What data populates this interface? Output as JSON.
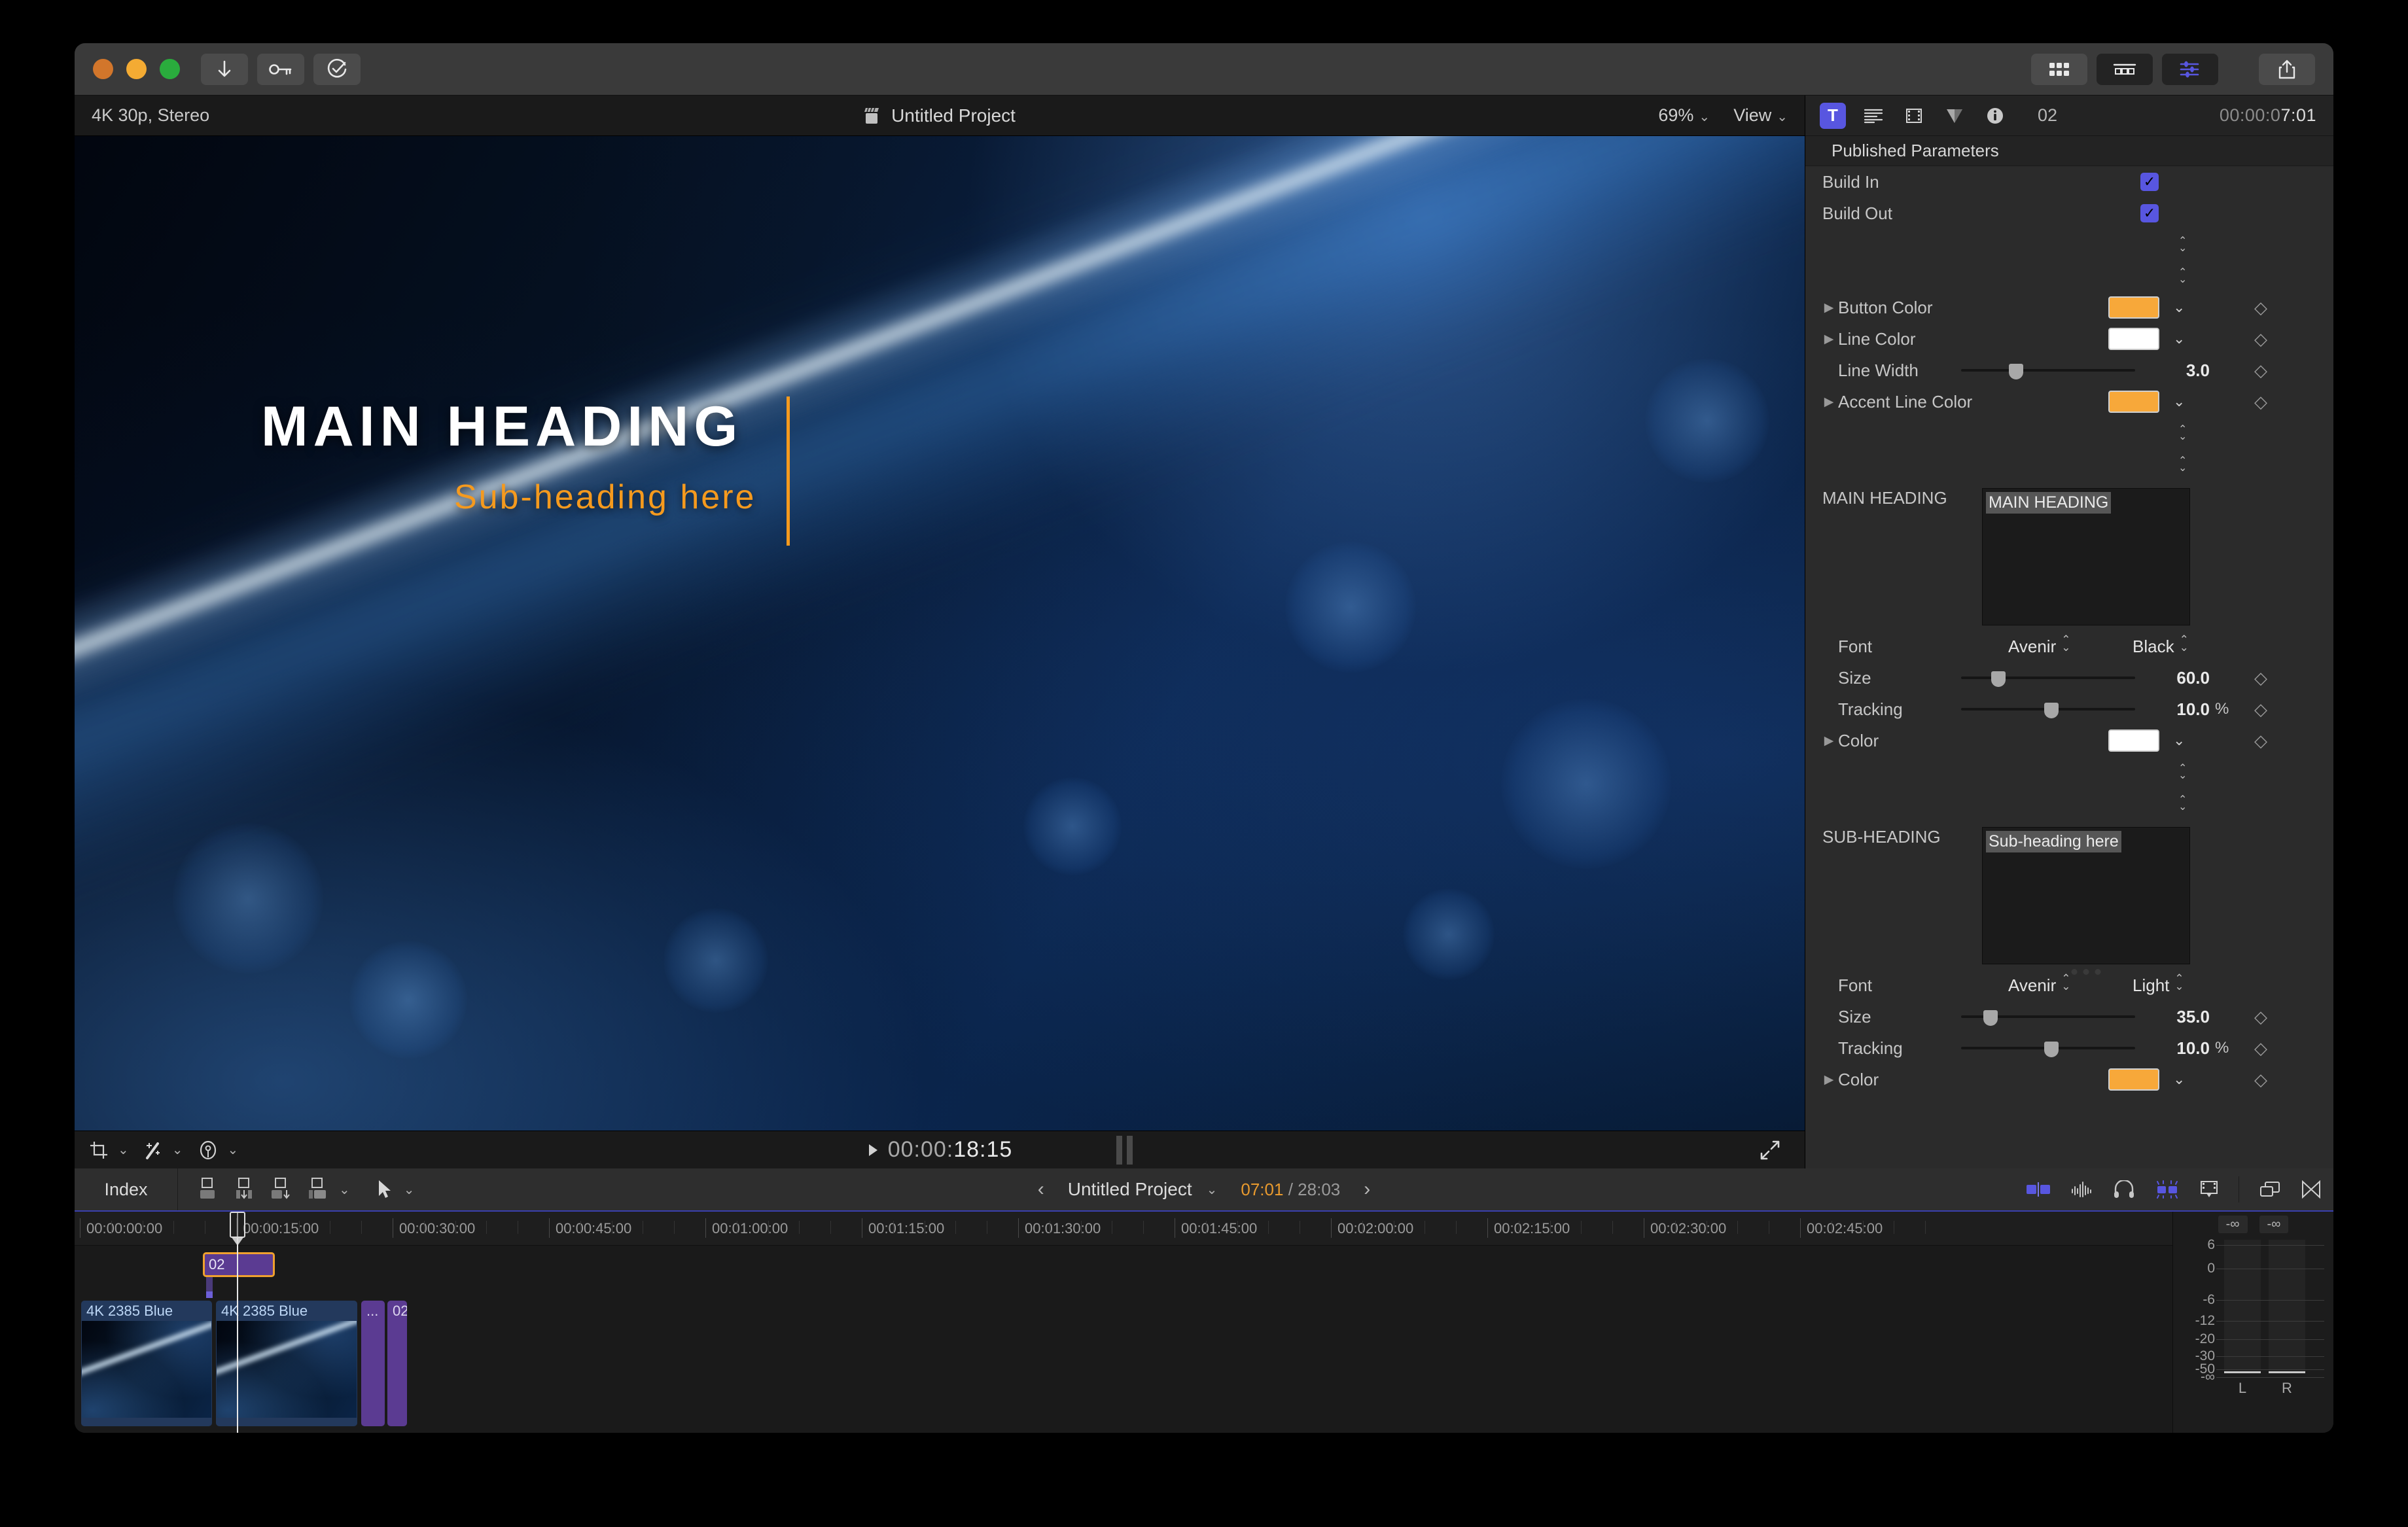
{
  "titlebar": {
    "buttons": [
      {
        "name": "download-button",
        "icon": "arrow-down-icon"
      },
      {
        "name": "keyword-button",
        "icon": "key-icon"
      },
      {
        "name": "analysis-button",
        "icon": "check-circle-icon"
      }
    ],
    "right_buttons": [
      {
        "name": "browser-button",
        "icon": "grid-icon"
      },
      {
        "name": "timeline-button",
        "icon": "filmstrip-icon"
      },
      {
        "name": "inspector-button",
        "icon": "sliders-icon"
      },
      {
        "name": "share-button",
        "icon": "share-icon"
      }
    ]
  },
  "viewer": {
    "format": "4K 30p, Stereo",
    "project_title": "Untitled Project",
    "zoom": "69%",
    "view_label": "View",
    "title_text": "MAIN HEADING",
    "sub_text": "Sub-heading here",
    "timecode_prefix": "00:00:",
    "timecode_main": "18:15",
    "tools": [
      "crop-icon",
      "transform-icon",
      "color-board-icon"
    ]
  },
  "inspector": {
    "tabs": [
      {
        "name": "text-tab",
        "label": "T",
        "active": true
      },
      {
        "name": "paragraph-tab",
        "label": "",
        "active": false
      },
      {
        "name": "video-tab",
        "label": "",
        "active": false
      },
      {
        "name": "generator-tab",
        "label": "",
        "active": false
      },
      {
        "name": "info-tab",
        "label": "",
        "active": false
      }
    ],
    "clip_number": "02",
    "timecode_dim": "00:00:0",
    "timecode_bright": "7:01",
    "section_title": "Published Parameters",
    "build_in": {
      "label": "Build In",
      "checked": true,
      "check_glyph": "✓"
    },
    "build_out": {
      "label": "Build Out",
      "checked": true,
      "check_glyph": "✓"
    },
    "button_color": {
      "label": "Button Color",
      "value": "#f7a83a"
    },
    "line_color": {
      "label": "Line Color",
      "value": "#ffffff"
    },
    "line_width": {
      "label": "Line Width",
      "value": "3.0",
      "knob_pct": 30
    },
    "accent_line_color": {
      "label": "Accent Line Color",
      "value": "#f7a83a"
    },
    "main_heading": {
      "label": "MAIN HEADING",
      "field_value": "MAIN HEADING",
      "font_label": "Font",
      "font_family": "Avenir",
      "font_style": "Black",
      "size_label": "Size",
      "size_value": "60.0",
      "size_knob_pct": 19,
      "tracking_label": "Tracking",
      "tracking_value": "10.0",
      "tracking_unit": "%",
      "tracking_knob_pct": 52,
      "color_label": "Color",
      "color_value": "#ffffff"
    },
    "sub_heading": {
      "label": "SUB-HEADING",
      "field_value": "Sub-heading here",
      "font_label": "Font",
      "font_family": "Avenir",
      "font_style": "Light",
      "size_label": "Size",
      "size_value": "35.0",
      "size_knob_pct": 14,
      "tracking_label": "Tracking",
      "tracking_value": "10.0",
      "tracking_unit": "%",
      "tracking_knob_pct": 52,
      "color_label": "Color",
      "color_value": "#f7a83a"
    }
  },
  "timeline": {
    "index_label": "Index",
    "project_name": "Untitled Project",
    "position": "07:01",
    "separator": "/",
    "duration": "28:03",
    "prev_arrow": "‹",
    "next_arrow": "›",
    "tools": [
      "connect-icon",
      "insert-icon",
      "append-icon",
      "overwrite-icon",
      "select-tool-icon"
    ],
    "right_tools": [
      "skimming-icon",
      "audio-skimming-icon",
      "solo-icon",
      "snapping-icon",
      "filmstrip-view-icon",
      "window-icon",
      "effects-icon"
    ],
    "ruler_labels": [
      "00:00:00:00",
      "00:00:15:00",
      "00:00:30:00",
      "00:00:45:00",
      "00:01:00:00",
      "00:01:15:00",
      "00:01:30:00",
      "00:01:45:00",
      "00:02:00:00",
      "00:02:15:00",
      "00:02:30:00",
      "00:02:45:00"
    ],
    "title_clip": {
      "label": "02"
    },
    "video_clips": [
      {
        "name": "4K 2385 Blue"
      },
      {
        "name": "4K 2385 Blue"
      }
    ],
    "purple_clips": [
      {
        "name": "..."
      },
      {
        "name": "02"
      }
    ]
  },
  "meters": {
    "readout_left": "-∞",
    "readout_right": "-∞",
    "scale": [
      "6",
      "0",
      "-6",
      "-12",
      "-20",
      "-30",
      "-50",
      "-∞"
    ],
    "label_l": "L",
    "label_r": "R"
  },
  "colors": {
    "accent_orange": "#f7a83a",
    "accent_blue": "#5856e0",
    "title_purple": "#5b3b92",
    "clip_blue": "#23395c"
  }
}
